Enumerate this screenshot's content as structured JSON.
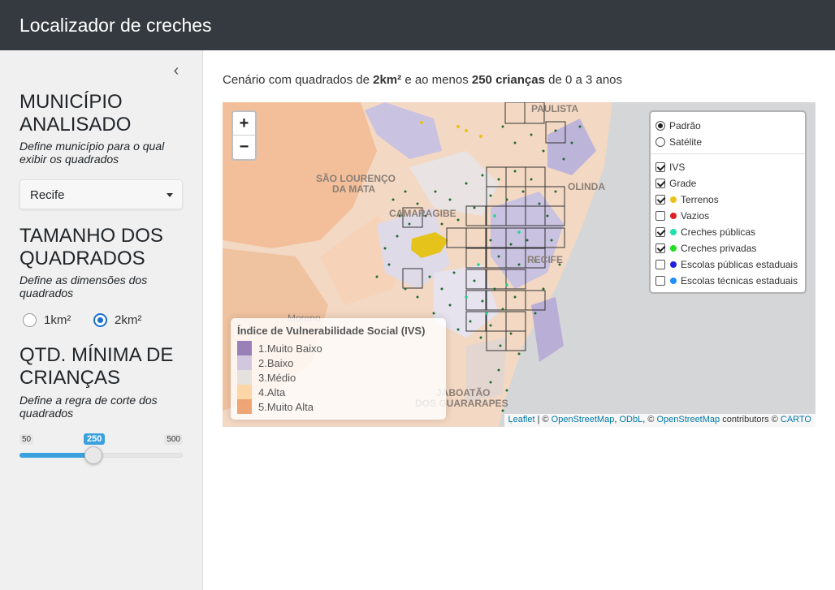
{
  "app": {
    "title": "Localizador de creches"
  },
  "sidebar": {
    "collapse_icon": "chevron-left-icon",
    "municipio": {
      "title": "MUNICÍPIO ANALISADO",
      "help": "Define município para o qual exibir os quadrados",
      "selected": "Recife"
    },
    "tamanho": {
      "title": "TAMANHO DOS QUADRADOS",
      "help": "Define as dimensões dos quadrados",
      "options": [
        {
          "label": "1km²",
          "selected": false
        },
        {
          "label": "2km²",
          "selected": true
        }
      ]
    },
    "qtd": {
      "title": "QTD. MÍNIMA DE CRIANÇAS",
      "help": "Define a regra de corte dos quadrados",
      "min": "50",
      "max": "500",
      "value": "250",
      "fraction": 0.444
    }
  },
  "main": {
    "subtitle": {
      "prefix": "Cenário com quadrados de ",
      "size": "2km²",
      "middle": " e ao menos ",
      "count": "250 crianças",
      "suffix": " de 0 a 3 anos"
    }
  },
  "map": {
    "zoom_in": "+",
    "zoom_out": "−",
    "place_labels": {
      "sao_lourenco_1": "SÃO LOURENÇO",
      "sao_lourenco_2": "DA MATA",
      "camaragibe": "CAMARAGIBE",
      "paulista": "PAULISTA",
      "olinda": "OLINDA",
      "recife": "RECIFE",
      "moreno": "Moreno",
      "jaboatao_1": "JABOATÃO",
      "jaboatao_2": "DOS GUARARAPES"
    },
    "base_layers": [
      {
        "label": "Padrão",
        "selected": true
      },
      {
        "label": "Satélite",
        "selected": false
      }
    ],
    "overlays": [
      {
        "label": "IVS",
        "checked": true,
        "color": ""
      },
      {
        "label": "Grade",
        "checked": true,
        "color": ""
      },
      {
        "label": "Terrenos",
        "checked": true,
        "color": "#e8c21a"
      },
      {
        "label": "Vazios",
        "checked": false,
        "color": "#e02020"
      },
      {
        "label": "Creches públicas",
        "checked": true,
        "color": "#20e0b0"
      },
      {
        "label": "Creches privadas",
        "checked": true,
        "color": "#20e020"
      },
      {
        "label": "Escolas públicas estaduais",
        "checked": false,
        "color": "#2020e0"
      },
      {
        "label": "Escolas técnicas estaduais",
        "checked": false,
        "color": "#1e90ff"
      }
    ],
    "legend": {
      "title": "Índice de Vulnerabilidade Social (IVS)",
      "items": [
        {
          "label": "1.Muito Baixo",
          "color": "#6f4fa3"
        },
        {
          "label": "2.Baixo",
          "color": "#bdb4d9"
        },
        {
          "label": "3.Médio",
          "color": "#d9d9d9"
        },
        {
          "label": "4.Alta",
          "color": "#fcc98a"
        },
        {
          "label": "5.Muito Alta",
          "color": "#e8823f"
        }
      ]
    },
    "attribution": {
      "leaflet": "Leaflet",
      "sep1": " | © ",
      "osm": "OpenStreetMap",
      "sep2": ", ",
      "odbl": "ODbL",
      "sep3": ", © ",
      "osm2": "OpenStreetMap",
      "contrib": " contributors © ",
      "carto": "CARTO"
    }
  }
}
